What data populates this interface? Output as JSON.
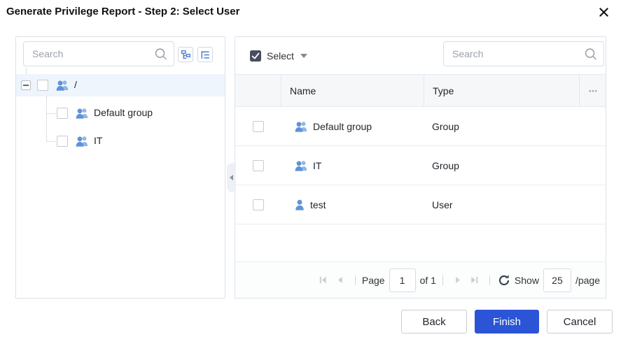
{
  "dialog": {
    "title": "Generate Privilege Report - Step 2: Select User"
  },
  "left_panel": {
    "search_placeholder": "Search",
    "tree": {
      "root": {
        "label": "/",
        "expanded": true,
        "checked": false,
        "selected": true,
        "icon": "group"
      },
      "children": [
        {
          "label": "Default group",
          "checked": false,
          "icon": "group"
        },
        {
          "label": "IT",
          "checked": false,
          "icon": "group"
        }
      ]
    }
  },
  "right_panel": {
    "select_label": "Select",
    "search_placeholder": "Search",
    "table": {
      "columns": [
        "Name",
        "Type"
      ],
      "more_label": "•••",
      "rows": [
        {
          "name": "Default group",
          "type": "Group",
          "icon": "group",
          "checked": false
        },
        {
          "name": "IT",
          "type": "Group",
          "icon": "group",
          "checked": false
        },
        {
          "name": "test",
          "type": "User",
          "icon": "user",
          "checked": false
        }
      ]
    },
    "pagination": {
      "page_label": "Page",
      "page_value": "1",
      "of_text": "of 1",
      "show_label": "Show",
      "page_size": "25",
      "per_page_label": "/page"
    }
  },
  "footer": {
    "back_label": "Back",
    "finish_label": "Finish",
    "cancel_label": "Cancel"
  },
  "colors": {
    "primary_button": "#2b54d6",
    "entity_icon_blue": "#5f92d8",
    "entity_icon_blue_light": "#93b5e4",
    "selected_tree_row": "#eef5fc",
    "table_header_bg": "#f6f7f9",
    "panel_border": "#dde2ea"
  }
}
